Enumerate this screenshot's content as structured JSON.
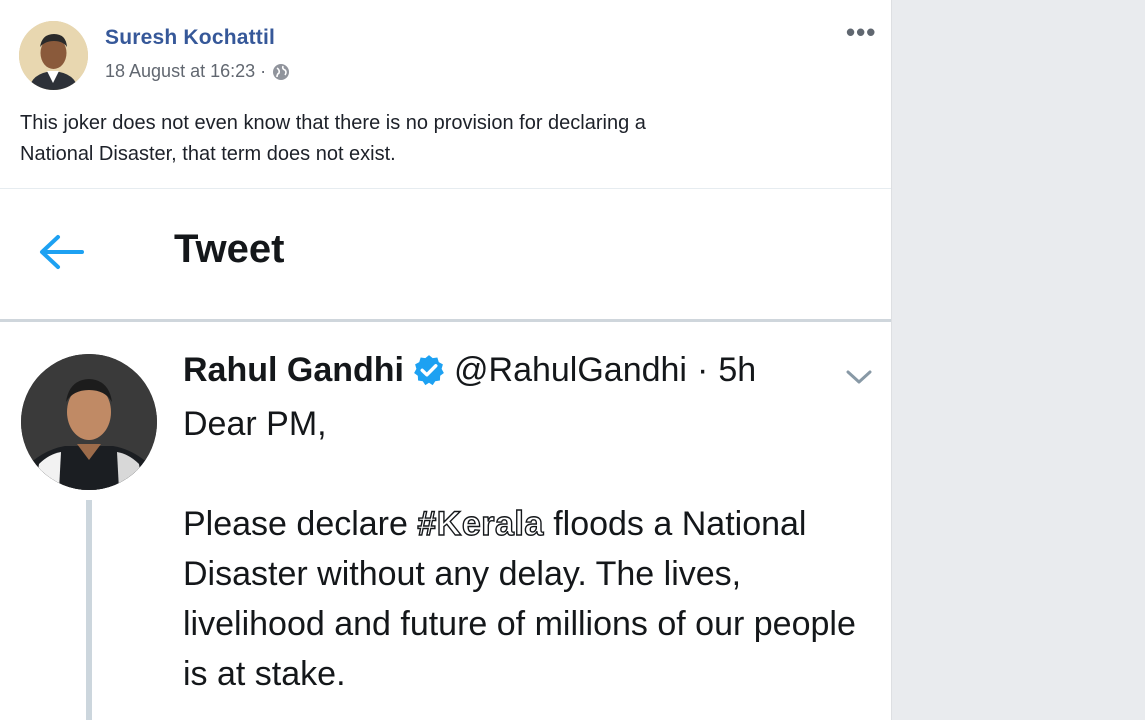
{
  "post": {
    "author": "Suresh Kochattil",
    "timestamp": "18 August at 16:23 ·",
    "privacy_icon": "globe-icon",
    "menu_label": "•••",
    "text_line1": "This joker does not even know that there is no provision for declaring a",
    "text_line2": "National Disaster, that term does not exist."
  },
  "tweet_view": {
    "back_icon": "back-arrow-icon",
    "heading": "Tweet",
    "tweet": {
      "name": "Rahul Gandhi",
      "verified_icon": "verified-badge-icon",
      "handle": "@RahulGandhi",
      "separator": "·",
      "age": "5h",
      "chevron_icon": "chevron-down-icon",
      "greeting": "Dear PM,",
      "body_before_tag": "Please declare ",
      "hashtag": "#Kerala",
      "body_after_tag": " floods a National Disaster without any delay. The lives, livelihood and future of millions of our people is at stake."
    }
  },
  "colors": {
    "fb_link": "#365899",
    "twitter_blue": "#1da1f2",
    "page_bg": "#e9ebee"
  }
}
